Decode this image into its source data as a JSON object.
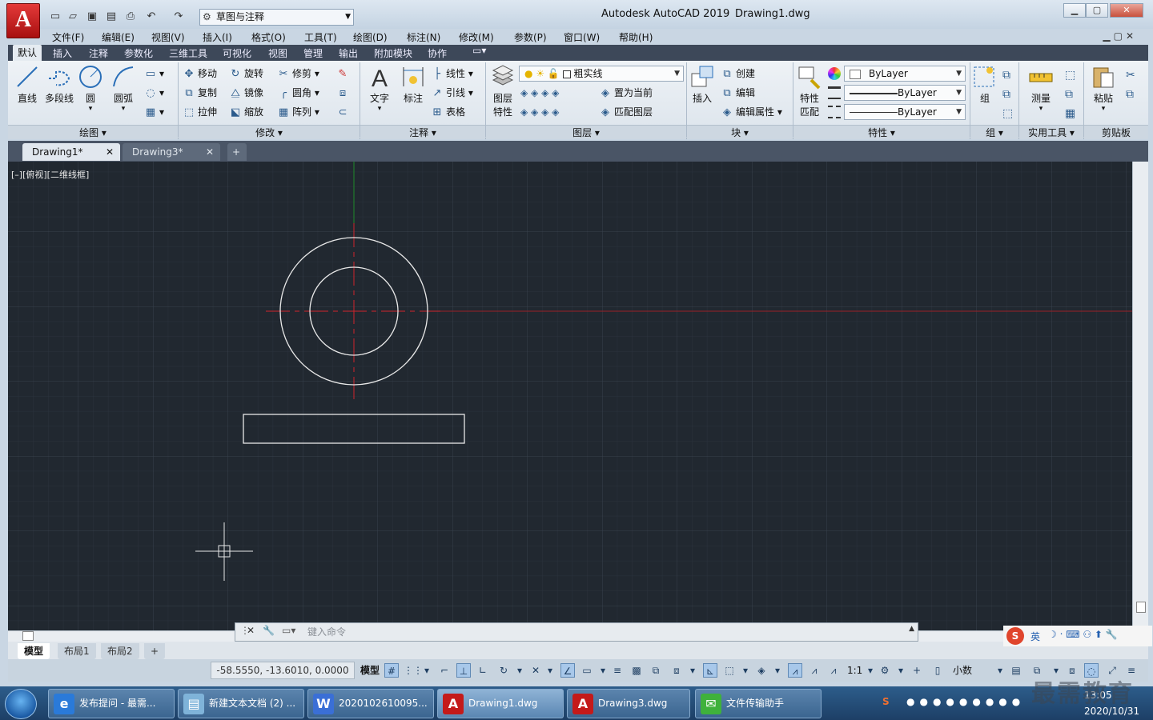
{
  "title_bar": {
    "app_title": "Autodesk AutoCAD 2019",
    "document_title": "Drawing1.dwg",
    "workspace": "草图与注释",
    "minimize": "▁",
    "maximize": "▢",
    "close": "✕"
  },
  "menu": [
    "文件(F)",
    "编辑(E)",
    "视图(V)",
    "插入(I)",
    "格式(O)",
    "工具(T)",
    "绘图(D)",
    "标注(N)",
    "修改(M)",
    "参数(P)",
    "窗口(W)",
    "帮助(H)"
  ],
  "ribbon_tabs": [
    "默认",
    "插入",
    "注释",
    "参数化",
    "三维工具",
    "可视化",
    "视图",
    "管理",
    "输出",
    "附加模块",
    "协作"
  ],
  "ribbon": {
    "draw": {
      "title": "绘图",
      "line": "直线",
      "polyline": "多段线",
      "circle": "圆",
      "arc": "圆弧"
    },
    "modify": {
      "title": "修改",
      "move": "移动",
      "rotate": "旋转",
      "trim": "修剪",
      "copy": "复制",
      "mirror": "镜像",
      "fillet": "圆角",
      "stretch": "拉伸",
      "scale": "缩放",
      "array": "阵列"
    },
    "annotation": {
      "title": "注释",
      "text": "文字",
      "dimension": "标注",
      "linear": "线性",
      "leader": "引线",
      "table": "表格"
    },
    "layers": {
      "title": "图层",
      "layer_properties_1": "图层",
      "layer_properties_2": "特性",
      "current_layer": "粗实线",
      "set_current": "置为当前",
      "match_layer": "匹配图层"
    },
    "block": {
      "title": "块",
      "insert": "插入",
      "create": "创建",
      "edit": "编辑",
      "edit_attributes": "编辑属性"
    },
    "properties": {
      "title": "特性",
      "match_1": "特性",
      "match_2": "匹配",
      "color": "ByLayer",
      "linetype": "ByLayer",
      "lineweight": "ByLayer"
    },
    "groups": {
      "title": "组",
      "group": "组"
    },
    "utilities": {
      "title": "实用工具",
      "measure": "测量"
    },
    "clipboard": {
      "title": "剪贴板",
      "paste": "粘贴"
    }
  },
  "doc_tabs": [
    "Drawing1*",
    "Drawing3*"
  ],
  "viewport_label": "[–][俯视][二维线框]",
  "command_placeholder": "键入命令",
  "layout_tabs": [
    "模型",
    "布局1",
    "布局2"
  ],
  "status": {
    "coordinates": "-58.5550, -13.6010, 0.0000",
    "model": "模型",
    "scale": "1:1",
    "units": "小数"
  },
  "taskbar": {
    "items": [
      "发布提问 - 最需...",
      "新建文本文档 (2) ...",
      "2020102610095...",
      "Drawing1.dwg",
      "Drawing3.dwg",
      "文件传输助手"
    ],
    "time": "13:05",
    "date": "2020/10/31",
    "watermark": "最需教育",
    "ime_label": "英"
  },
  "colors": {
    "canvas_bg": "#212830",
    "axis_red": "#c0242c",
    "axis_green": "#1f8a2a",
    "geometry": "#e8e8e8"
  }
}
